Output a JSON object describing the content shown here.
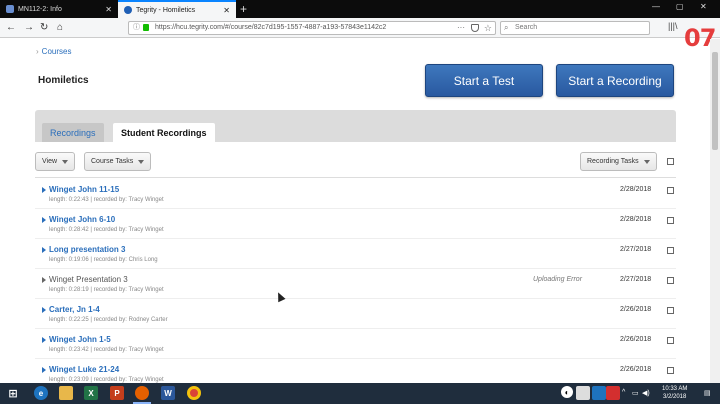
{
  "browser": {
    "tabs": [
      {
        "title": "MN112-2: Info",
        "favicon_color": "#6a8fd1"
      },
      {
        "title": "Tegrity - Homiletics",
        "favicon_color": "#1f5fb5"
      }
    ],
    "url": "https://hcu.tegrity.com/#/course/82c7d195-1557-4887-a193-57843e1142c2",
    "search_placeholder": "Search",
    "badge": "07"
  },
  "page": {
    "breadcrumb": "Courses",
    "course_title": "Homiletics",
    "start_test_label": "Start a Test",
    "start_recording_label": "Start a Recording",
    "tabs": [
      {
        "label": "Recordings"
      },
      {
        "label": "Student Recordings"
      }
    ],
    "view_label": "View",
    "course_tasks_label": "Course Tasks",
    "recording_tasks_label": "Recording Tasks"
  },
  "recordings": [
    {
      "title": "Winget John 11-15",
      "meta": "length: 0:22:43 | recorded by: Tracy Winget",
      "status": "",
      "date": "2/28/2018"
    },
    {
      "title": "Winget John 6-10",
      "meta": "length: 0:28:42 | recorded by: Tracy Winget",
      "status": "",
      "date": "2/28/2018"
    },
    {
      "title": "Long presentation 3",
      "meta": "length: 0:19:06 | recorded by: Chris Long",
      "status": "",
      "date": "2/27/2018"
    },
    {
      "title": "Winget Presentation 3",
      "meta": "length: 0:28:19 | recorded by: Tracy Winget",
      "status": "Uploading Error",
      "date": "2/27/2018"
    },
    {
      "title": "Carter, Jn 1-4",
      "meta": "length: 0:22:25 | recorded by: Rodney Carter",
      "status": "",
      "date": "2/26/2018"
    },
    {
      "title": "Winget John 1-5",
      "meta": "length: 0:23:42 | recorded by: Tracy Winget",
      "status": "",
      "date": "2/26/2018"
    },
    {
      "title": "Winget Luke 21-24",
      "meta": "length: 0:23:09 | recorded by: Tracy Winget",
      "status": "",
      "date": "2/26/2018"
    }
  ],
  "taskbar": {
    "clock_time": "10:33 AM",
    "clock_date": "3/2/2018"
  },
  "colors": {
    "accent": "#2a6ebb",
    "button_blue": "#2f63a8",
    "taskbar": "#1f2d3d"
  }
}
